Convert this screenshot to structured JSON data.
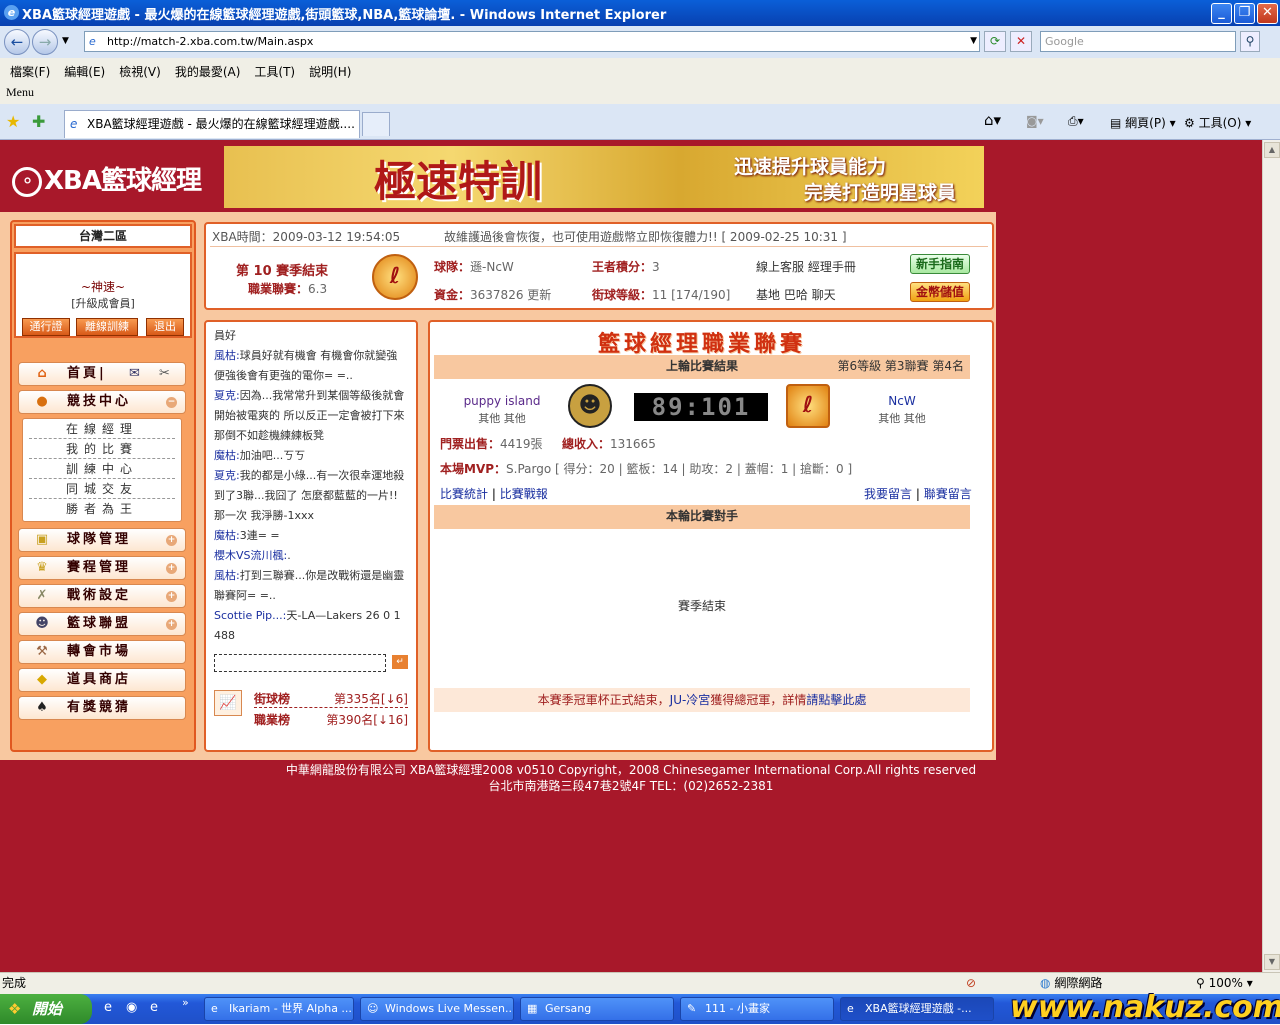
{
  "window": {
    "title": "XBA籃球經理遊戲 - 最火爆的在線籃球經理遊戲,街頭籃球,NBA,籃球論壇. - Windows Internet Explorer"
  },
  "browser": {
    "url": "http://match-2.xba.com.tw/Main.aspx",
    "search_placeholder": "Google",
    "menu": [
      "檔案(F)",
      "編輯(E)",
      "檢視(V)",
      "我的最愛(A)",
      "工具(T)",
      "說明(H)"
    ],
    "menu_label": "Menu",
    "tab_title": "XBA籃球經理遊戲 - 最火爆的在線籃球經理遊戲....",
    "page_menu": "網頁(P)",
    "tools_menu": "工具(O)",
    "status": "完成",
    "zone": "網際網路",
    "zoom": "100%"
  },
  "header": {
    "logo": "XBA籃球經理",
    "banner_title": "極速特訓",
    "banner_line1": "迅速提升球員能力",
    "banner_line2": "完美打造明星球員"
  },
  "sidebar": {
    "server": "台灣二區",
    "user_name": "~神速~",
    "user_level": "[升級成會員]",
    "btn_pass": "通行證",
    "btn_offline": "離線訓練",
    "btn_logout": "退出",
    "home": "首頁|",
    "nav": [
      {
        "label": "競技中心",
        "icon": "basketball-icon"
      },
      {
        "label": "球隊管理",
        "icon": "clipboard-icon"
      },
      {
        "label": "賽程管理",
        "icon": "trophy-icon"
      },
      {
        "label": "戰術設定",
        "icon": "tactics-icon"
      },
      {
        "label": "籃球聯盟",
        "icon": "people-icon"
      },
      {
        "label": "轉會市場",
        "icon": "hammer-icon"
      },
      {
        "label": "道具商店",
        "icon": "gold-icon"
      },
      {
        "label": "有獎競猜",
        "icon": "spade-icon"
      }
    ],
    "subnav": [
      "在線經理",
      "我的比賽",
      "訓練中心",
      "同城交友",
      "勝者為王"
    ]
  },
  "info": {
    "time_label": "XBA時間：",
    "time_value": "2009-03-12 19:54:05",
    "notice": "故維護過後會恢復，也可使用遊戲幣立即恢復體力!! [ 2009-02-25 10:31 ]",
    "season": "第 10 賽季結束",
    "career_label": "職業聯賽：",
    "career_value": "6.3",
    "team_label": "球隊：",
    "team_value": "遜-NcW",
    "king_label": "王者積分：",
    "king_value": "3",
    "online_links": "線上客服  經理手冊",
    "money_label": "資金：",
    "money_value": "3637826",
    "money_update": "更新",
    "street_label": "街球等級：",
    "street_value": "11 [174/190]",
    "base_links": "基地  巴哈  聊天",
    "btn_guide": "新手指南",
    "btn_gold": "金幣儲值"
  },
  "chat": {
    "greeting": "員好",
    "messages": [
      {
        "name": "風枯:",
        "text": "球員好就有機會  有機會你就變強  便強後會有更強的電你= =.."
      },
      {
        "name": "夏克:",
        "text": "因為...我常常升到某個等級後就會開始被電爽的  所以反正一定會被打下來  那倒不如趁機練練板凳"
      },
      {
        "name": "魔枯:",
        "text": "加油吧...ㄎㄎ"
      },
      {
        "name": "夏克:",
        "text": "我的都是小綠...有一次很幸運地殺到了3聯...我囧了  怎麼都藍藍的一片!!那一次  我淨勝-1xxx"
      },
      {
        "name": "魔枯:",
        "text": "3連= ="
      },
      {
        "name": "櫻木VS流川楓:",
        "text": "."
      },
      {
        "name": "風枯:",
        "text": "打到三聯賽...你是改戰術還是幽靈聯賽阿= =.."
      },
      {
        "name": "Scottie Pip...:",
        "text": "天-LA—Lakers 26 0 1 488"
      }
    ],
    "rank1_label": "街球榜",
    "rank1_value": "第335名[↓6]",
    "rank2_label": "職業榜",
    "rank2_value": "第390名[↓16]"
  },
  "league": {
    "title": "籃球經理職業聯賽",
    "last_result": "上輪比賽結果",
    "level_info": "第6等級  第3聯賽  第4名",
    "home_team": "puppy island",
    "home_sub": "其他  其他",
    "away_team": "NcW",
    "away_sub": "其他  其他",
    "score": "89:101",
    "tickets_label": "門票出售：",
    "tickets_value": "4419張",
    "income_label": "總收入：",
    "income_value": "131665",
    "mvp_label": "本場MVP：",
    "mvp_value": "S.Pargo  [ 得分：20 | 籃板：14 | 助攻：2 | 蓋帽：1 | 搶斷：0 ]",
    "stats_link": "比賽統計",
    "report_link": "比賽戰報",
    "msg_link": "我要留言",
    "league_msg_link": "聯賽留言",
    "next_opponent": "本輪比賽對手",
    "season_end": "賽季結束",
    "champion_prefix": "本賽季冠軍杯正式結束，",
    "champion_name": "JU-冷宮",
    "champion_suffix": "獲得總冠軍，詳情",
    "champion_link": "請點擊此處"
  },
  "footer": {
    "line1": "中華網龍股份有限公司  XBA籃球經理2008 v0510    Copyright，2008 Chinesegamer International Corp.All rights reserved",
    "line2": "台北市南港路三段47巷2號4F TEL：(02)2652-2381"
  },
  "taskbar": {
    "start": "開始",
    "tasks": [
      "Ikariam - 世界 Alpha ...",
      "Windows Live Messen...",
      "Gersang",
      "111 - 小畫家",
      "XBA籃球經理遊戲 -..."
    ],
    "watermark": "www.nakuz.com"
  }
}
